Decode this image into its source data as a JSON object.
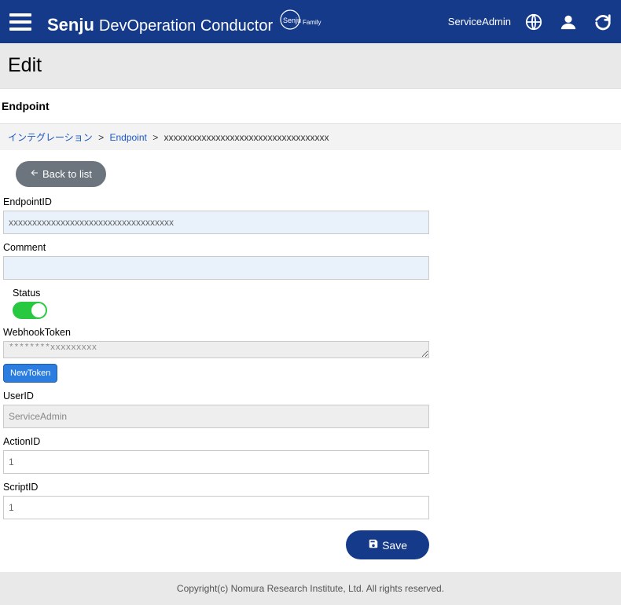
{
  "header": {
    "brand_main": "Senju",
    "brand_sub": "DevOperation Conductor",
    "brand_family": "Senju Family",
    "user_label": "ServiceAdmin"
  },
  "page": {
    "title": "Edit",
    "panel_heading": "Endpoint"
  },
  "breadcrumb": {
    "item1": "インテグレーション",
    "item2": "Endpoint",
    "current": "xxxxxxxxxxxxxxxxxxxxxxxxxxxxxxxxxxx"
  },
  "buttons": {
    "back": "Back to list",
    "new_token": "NewToken",
    "save": "Save"
  },
  "form": {
    "endpoint_id": {
      "label": "EndpointID",
      "value": "xxxxxxxxxxxxxxxxxxxxxxxxxxxxxxxxxxx"
    },
    "comment": {
      "label": "Comment",
      "value": ""
    },
    "status": {
      "label": "Status",
      "on": true
    },
    "webhook": {
      "label": "WebhookToken",
      "value": "********xxxxxxxxx"
    },
    "user_id": {
      "label": "UserID",
      "value": "ServiceAdmin"
    },
    "action_id": {
      "label": "ActionID",
      "value": "1"
    },
    "script_id": {
      "label": "ScriptID",
      "value": "1"
    }
  },
  "footer": {
    "copyright": "Copyright(c) Nomura Research Institute, Ltd. All rights reserved."
  }
}
